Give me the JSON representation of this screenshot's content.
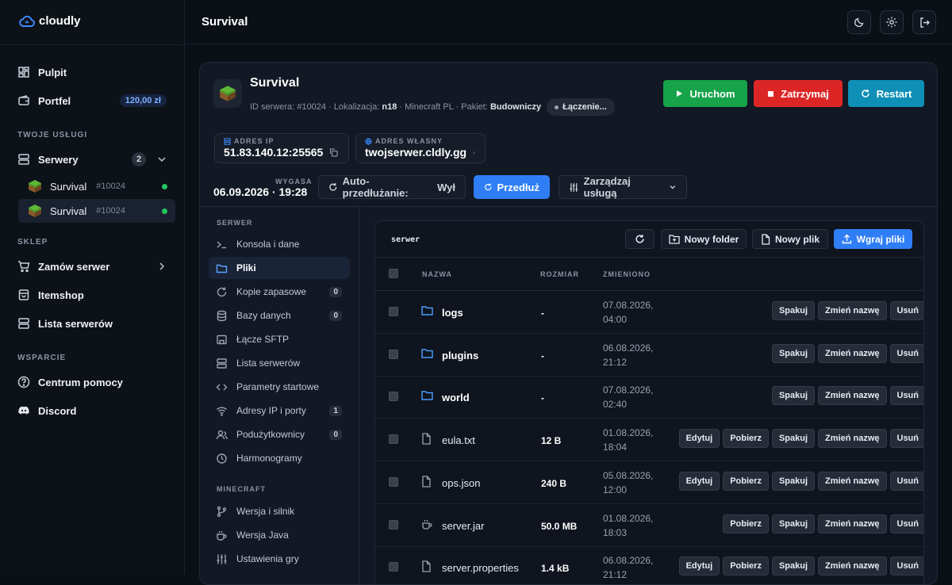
{
  "app": {
    "name": "cloudly",
    "page_title": "Survival"
  },
  "sidebar": {
    "dashboard": "Pulpit",
    "wallet": {
      "label": "Portfel",
      "balance": "120,00 zł"
    },
    "services_title": "TWOJE USŁUGI",
    "servers": {
      "label": "Serwery",
      "count": "2"
    },
    "server_list": [
      {
        "name": "Survival",
        "id": "#10024"
      },
      {
        "name": "Survival",
        "id": "#10024"
      }
    ],
    "shop_title": "SKLEP",
    "order": "Zamów serwer",
    "itemshop": "Itemshop",
    "server_list_link": "Lista serwerów",
    "support_title": "WSPARCIE",
    "help": "Centrum pomocy",
    "discord": "Discord"
  },
  "server": {
    "name": "Survival",
    "id_label": "ID serwera:",
    "id": "#10024",
    "location_label": "Lokalizacja:",
    "location": "n18",
    "game": "Minecraft PL",
    "package_label": "Pakiet:",
    "package": "Budowniczy",
    "status": "Łączenie..."
  },
  "actions": {
    "start": "Uruchom",
    "stop": "Zatrzymaj",
    "restart": "Restart"
  },
  "addresses": {
    "ip_label": "ADRES IP",
    "ip": "51.83.140.12:25565",
    "custom_label": "ADRES WŁASNY",
    "custom": "twojserwer.cldly.gg"
  },
  "expiry": {
    "label": "WYGASA",
    "value": "06.09.2026 · 19:28"
  },
  "renewal": {
    "auto_label": "Auto-przedłużanie:",
    "auto_value": "Wył",
    "extend": "Przedłuż",
    "manage": "Zarządzaj usługą"
  },
  "left_nav": {
    "server_title": "SERWER",
    "items": [
      {
        "label": "Konsola i dane",
        "count": ""
      },
      {
        "label": "Pliki",
        "count": ""
      },
      {
        "label": "Kopie zapasowe",
        "count": "0"
      },
      {
        "label": "Bazy danych",
        "count": "0"
      },
      {
        "label": "Łącze SFTP",
        "count": ""
      },
      {
        "label": "Lista serwerów",
        "count": ""
      },
      {
        "label": "Parametry startowe",
        "count": ""
      },
      {
        "label": "Adresy IP i porty",
        "count": "1"
      },
      {
        "label": "Podużytkownicy",
        "count": "0"
      },
      {
        "label": "Harmonogramy",
        "count": ""
      }
    ],
    "minecraft_title": "MINECRAFT",
    "mc_items": [
      {
        "label": "Wersja i silnik"
      },
      {
        "label": "Wersja Java"
      },
      {
        "label": "Ustawienia gry"
      }
    ]
  },
  "file_manager": {
    "path": "serwer",
    "new_folder": "Nowy folder",
    "new_file": "Nowy plik",
    "upload": "Wgraj pliki",
    "columns": {
      "name": "NAZWA",
      "size": "ROZMIAR",
      "modified": "ZMIENIONO"
    },
    "action_labels": {
      "edit": "Edytuj",
      "download": "Pobierz",
      "zip": "Spakuj",
      "rename": "Zmień nazwę",
      "delete": "Usuń"
    },
    "files": [
      {
        "name": "logs",
        "type": "folder",
        "size": "-",
        "date": "07.08.2026,",
        "time": "04:00"
      },
      {
        "name": "plugins",
        "type": "folder",
        "size": "-",
        "date": "06.08.2026,",
        "time": "21:12"
      },
      {
        "name": "world",
        "type": "folder",
        "size": "-",
        "date": "07.08.2026,",
        "time": "02:40"
      },
      {
        "name": "eula.txt",
        "type": "file",
        "size": "12 B",
        "date": "01.08.2026,",
        "time": "18:04"
      },
      {
        "name": "ops.json",
        "type": "file",
        "size": "240 B",
        "date": "05.08.2026,",
        "time": "12:00"
      },
      {
        "name": "server.jar",
        "type": "jar",
        "size": "50.0 MB",
        "date": "01.08.2026,",
        "time": "18:03"
      },
      {
        "name": "server.properties",
        "type": "file",
        "size": "1.4 kB",
        "date": "06.08.2026,",
        "time": "21:12"
      }
    ]
  },
  "colors": {
    "start": "#16a34a",
    "stop": "#dc2626",
    "restart": "#0e8fb5",
    "accent": "#2f7ef5",
    "online": "#22c55e"
  }
}
